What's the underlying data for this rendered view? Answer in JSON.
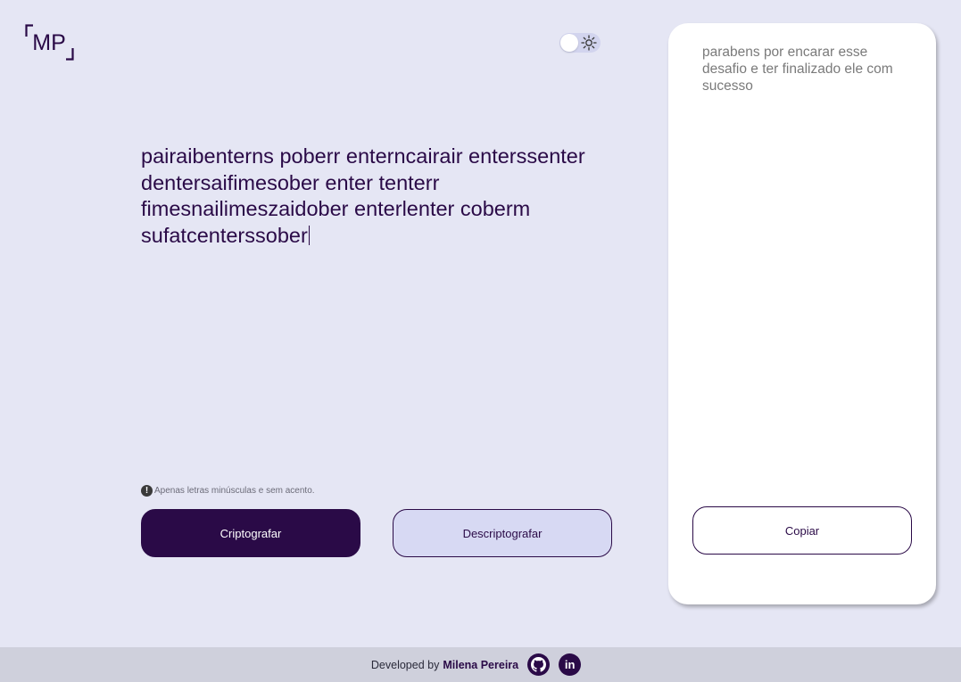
{
  "logo": {
    "text": "MP"
  },
  "theme_toggle": {
    "icon": "sun-icon"
  },
  "input": {
    "text": "pairaibenterns poberr enterncairair enterssenter dentersaifimesober enter tenterr fimesnailimeszaidober enterlenter coberm sufatcenterssober"
  },
  "hint": {
    "text": "Apenas letras minúsculas e sem acento."
  },
  "buttons": {
    "encrypt_label": "Criptografar",
    "decrypt_label": "Descriptografar",
    "copy_label": "Copiar"
  },
  "output": {
    "text": "parabens por encarar esse desafio e ter finalizado ele com sucesso"
  },
  "footer": {
    "developed_by": "Developed by",
    "author": "Milena Pereira",
    "github_icon": "github-icon",
    "linkedin_icon": "linkedin-icon",
    "linkedin_glyph": "in"
  },
  "colors": {
    "background": "#e5e6f4",
    "primary": "#2a0a47",
    "secondary_button": "#d7d9f3",
    "panel": "#ffffff",
    "footer": "#cfd0dc"
  }
}
